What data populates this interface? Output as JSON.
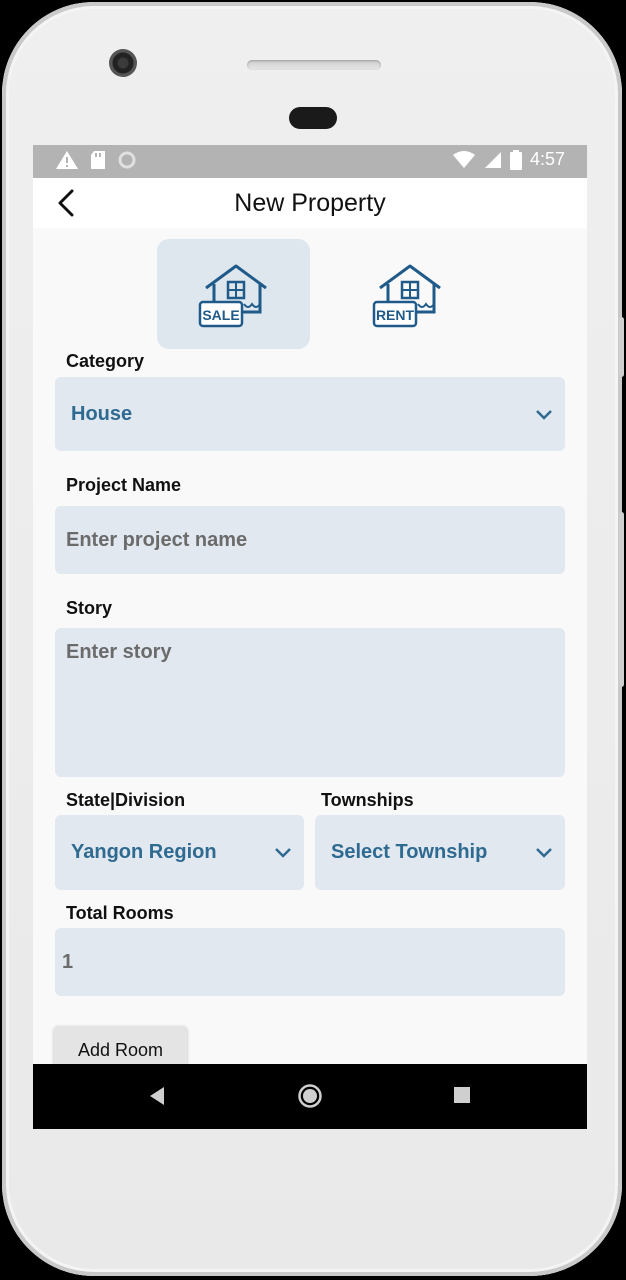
{
  "status_bar": {
    "time": "4:57",
    "icons_left": [
      "warning-icon",
      "sd-card-icon",
      "circle-icon"
    ],
    "icons_right": [
      "wifi-icon",
      "signal-icon",
      "battery-icon"
    ]
  },
  "app_bar": {
    "title": "New Property",
    "back_icon": "chevron-left-icon"
  },
  "listing_types": [
    {
      "label": "SALE",
      "selected": true
    },
    {
      "label": "RENT",
      "selected": false
    }
  ],
  "form": {
    "category": {
      "label": "Category",
      "value": "House"
    },
    "project_name": {
      "label": "Project Name",
      "placeholder": "Enter project name"
    },
    "story": {
      "label": "Story",
      "placeholder": "Enter story"
    },
    "state_division": {
      "label": "State|Division",
      "value": "Yangon Region"
    },
    "townships": {
      "label": "Townships",
      "value": "Select Township"
    },
    "total_rooms": {
      "label": "Total Rooms",
      "value": "1"
    },
    "add_room_label": "Add Room"
  },
  "colors": {
    "accent_blue": "#2f6a91",
    "field_bg": "#e2e8ef",
    "selected_card_bg": "#dee6ee",
    "icon_blue": "#1f5a89"
  },
  "nav_bar": [
    "back-triangle-icon",
    "home-circle-icon",
    "recents-square-icon"
  ]
}
